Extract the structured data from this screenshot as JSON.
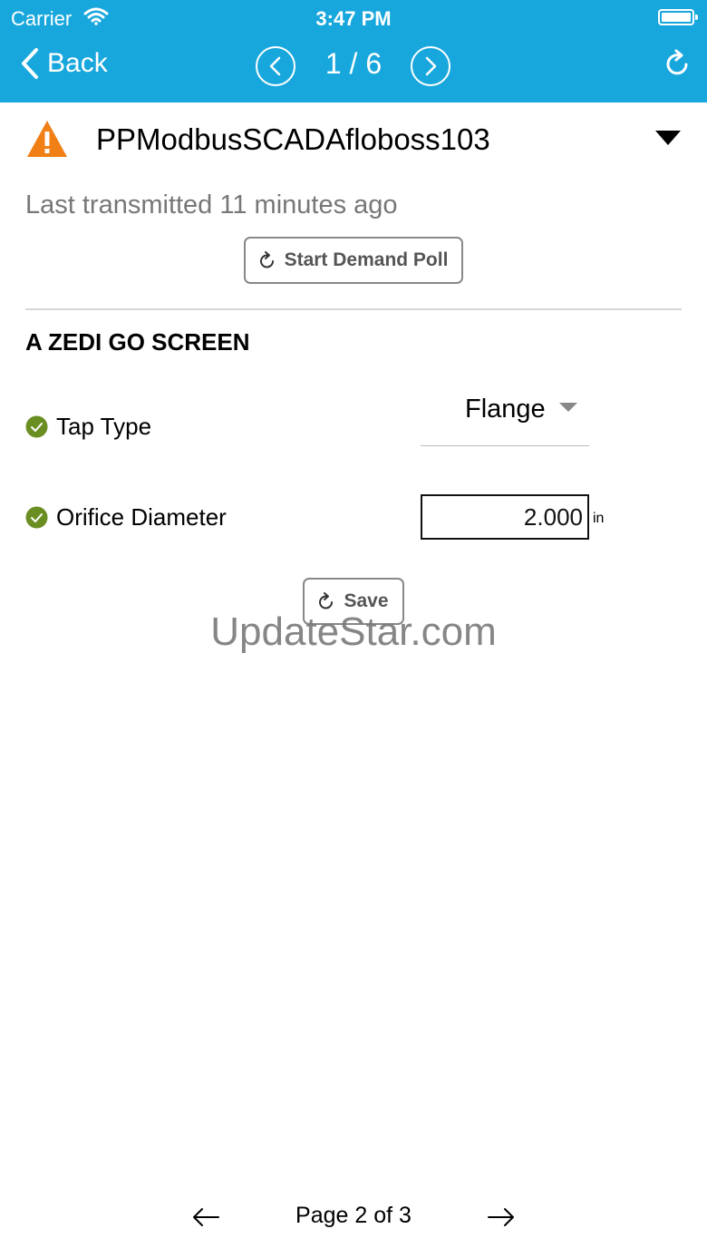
{
  "status_bar": {
    "carrier": "Carrier",
    "time": "3:47 PM",
    "wifi_icon": "wifi-icon",
    "battery_icon": "battery-icon"
  },
  "nav": {
    "back_label": "Back",
    "counter": "1 / 6",
    "prev_icon": "chevron-left-circle-icon",
    "next_icon": "chevron-right-circle-icon",
    "refresh_icon": "refresh-icon"
  },
  "device": {
    "name": "PPModbusSCADAfloboss103",
    "alert_icon": "warning-triangle-icon",
    "alert_color": "#f07f16",
    "last_transmitted": "Last transmitted 11 minutes ago",
    "demand_poll_label": "Start Demand Poll"
  },
  "section": {
    "title": "A ZEDI GO SCREEN",
    "fields": [
      {
        "label": "Tap Type",
        "value": "Flange",
        "status_icon": "check-circle-icon"
      },
      {
        "label": "Orifice Diameter",
        "value": "2.000",
        "unit": "in",
        "status_icon": "check-circle-icon"
      }
    ],
    "save_label": "Save"
  },
  "watermark": "UpdateStar.com",
  "pager": {
    "label": "Page 2 of 3",
    "prev_icon": "arrow-left-icon",
    "next_icon": "arrow-right-icon"
  },
  "colors": {
    "header": "#18a7dd",
    "check": "#6b8e23",
    "warning": "#f07f16"
  }
}
